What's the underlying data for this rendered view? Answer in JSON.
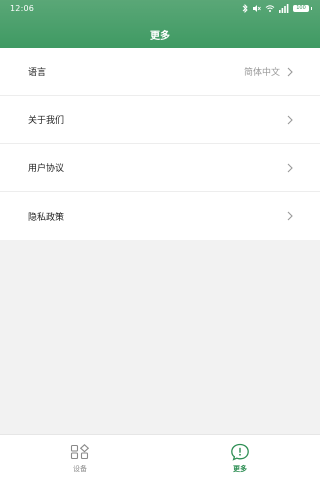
{
  "status_bar": {
    "time": "12:06",
    "battery_text": "100",
    "icons": [
      "bluetooth-icon",
      "mute-icon",
      "wifi-icon",
      "signal-icon",
      "battery-icon"
    ]
  },
  "header": {
    "title": "更多"
  },
  "menu": {
    "items": [
      {
        "label": "语言",
        "value": "简体中文",
        "icon": "chevron-right-icon"
      },
      {
        "label": "关于我们",
        "icon": "chevron-right-icon"
      },
      {
        "label": "用户协议",
        "icon": "chevron-right-icon"
      },
      {
        "label": "隐私政策",
        "icon": "chevron-right-icon"
      }
    ]
  },
  "tab_bar": {
    "tabs": [
      {
        "label": "设备",
        "icon": "devices-grid-icon",
        "active": false
      },
      {
        "label": "更多",
        "icon": "more-info-icon",
        "active": true
      }
    ]
  },
  "colors": {
    "header_green": "#3f9a63",
    "active_tab": "#2f8f55",
    "inactive_tab": "#8a8a8a",
    "background": "#f2f2f2"
  }
}
